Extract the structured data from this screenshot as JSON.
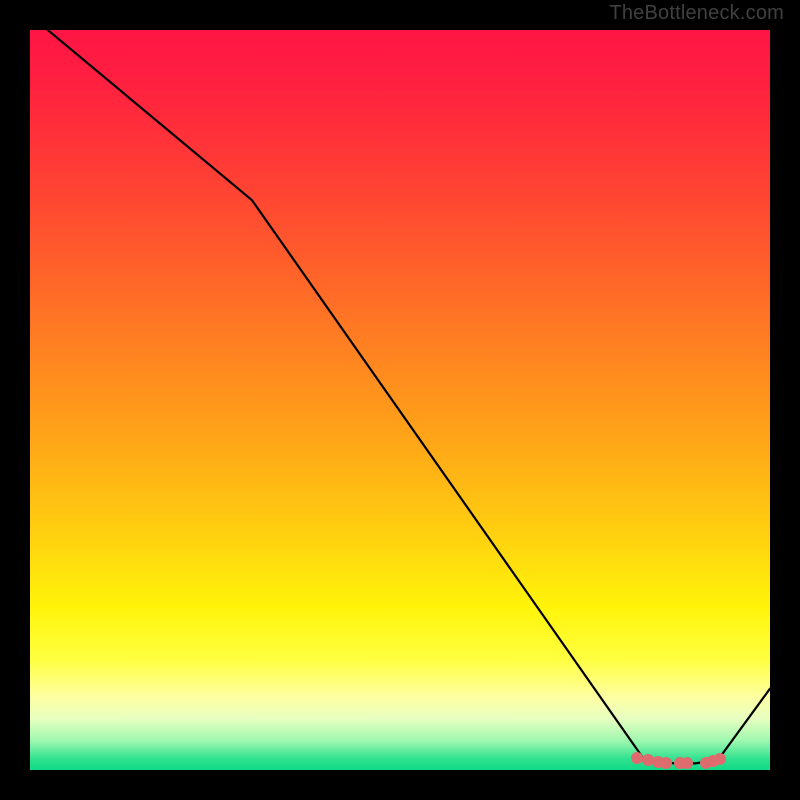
{
  "attribution": "TheBottleneck.com",
  "colors": {
    "frame": "#000000",
    "curve": "#000000",
    "marker": "#de6b6d",
    "gradient_stops": [
      {
        "offset": 0.0,
        "color": "#ff1545"
      },
      {
        "offset": 0.07,
        "color": "#ff2040"
      },
      {
        "offset": 0.18,
        "color": "#ff3a36"
      },
      {
        "offset": 0.3,
        "color": "#ff5a2c"
      },
      {
        "offset": 0.42,
        "color": "#ff7e22"
      },
      {
        "offset": 0.55,
        "color": "#ffa418"
      },
      {
        "offset": 0.67,
        "color": "#ffcc10"
      },
      {
        "offset": 0.78,
        "color": "#fff40a"
      },
      {
        "offset": 0.85,
        "color": "#ffff40"
      },
      {
        "offset": 0.9,
        "color": "#ffffa0"
      },
      {
        "offset": 0.93,
        "color": "#e8ffc0"
      },
      {
        "offset": 0.96,
        "color": "#a0f8b0"
      },
      {
        "offset": 0.985,
        "color": "#2fe28f"
      },
      {
        "offset": 1.0,
        "color": "#11d985"
      }
    ]
  },
  "chart_data": {
    "type": "line",
    "title": "",
    "xlabel": "",
    "ylabel": "",
    "xlim": [
      0,
      100
    ],
    "ylim": [
      0,
      100
    ],
    "grid": false,
    "series": [
      {
        "name": "bottleneck-curve",
        "x": [
          0,
          30,
          83,
          87,
          90,
          93,
          100
        ],
        "y": [
          102,
          77,
          1.4,
          0.9,
          0.9,
          1.4,
          11
        ]
      }
    ],
    "markers": {
      "name": "optimal-range",
      "x": [
        82.0,
        83.5,
        84.8,
        86.0,
        87.8,
        88.8,
        91.3,
        92.3,
        93.3
      ],
      "y": [
        1.6,
        1.4,
        1.1,
        1.0,
        0.9,
        0.9,
        1.0,
        1.2,
        1.5
      ]
    }
  }
}
